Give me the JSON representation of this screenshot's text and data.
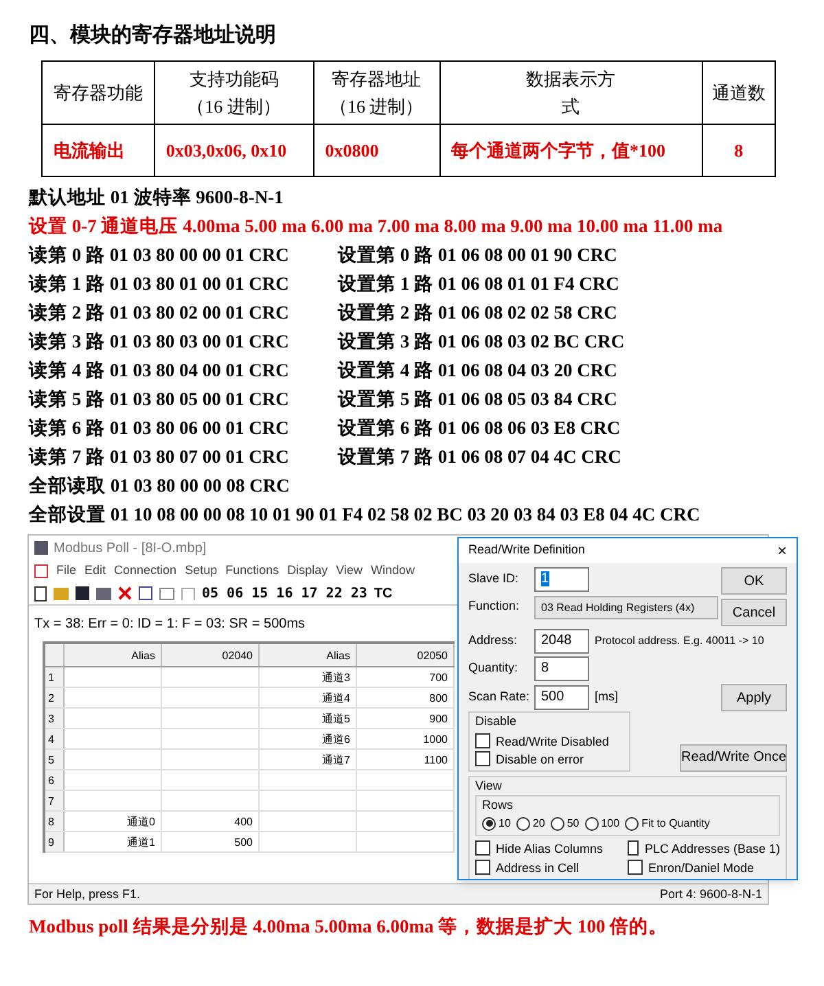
{
  "heading": "四、模块的寄存器地址说明",
  "table": {
    "columns": [
      "寄存器功能",
      "支持功能码（16 进制）",
      "寄存器地址（16 进制）",
      "数据表示方式",
      "通道数"
    ],
    "rows": [
      [
        "电流输出",
        "0x03,0x06, 0x10",
        "0x0800",
        "每个通道两个字节，值*100",
        "8"
      ]
    ]
  },
  "default_line": "默认地址 01 波特率 9600-8-N-1",
  "set_line": "设置 0-7 通道电压 **4.00ma 5.00 ma 6.00 ma 7.00 ma 8.00 ma 9.00 ma 10.00 ma 11.00 ma**",
  "commands": [
    {
      "read": "读第 0 路 01 03 80 00 00 01 CRC",
      "write": "设置第 0 路 01 06 08 00 01 90 CRC"
    },
    {
      "read": "读第 1 路 01 03 80 01 00 01 CRC",
      "write": "设置第 1 路 01 06 08 01 01 F4 CRC"
    },
    {
      "read": "读第 2 路 01 03 80 02 00 01 CRC",
      "write": "设置第 2 路 01 06 08 02 02 58 CRC"
    },
    {
      "read": "读第 3 路 01 03 80 03 00 01 CRC",
      "write": "设置第 3 路 01 06 08 03 02 BC CRC"
    },
    {
      "read": "读第 4 路 01 03 80 04 00 01 CRC",
      "write": "设置第 4 路 01 06 08 04 03 20 CRC"
    },
    {
      "read": "读第 5 路 01 03 80 05 00 01 CRC",
      "write": "设置第 5 路 01 06 08 05 03 84 CRC"
    },
    {
      "read": "读第 6 路 01 03 80 06 00 01 CRC",
      "write": "设置第 6 路 01 06 08 06 03 E8 CRC"
    },
    {
      "read": "读第 7 路 01 03 80 07 00 01 CRC",
      "write": "设置第 7 路 01 06 08 07 04 4C CRC"
    }
  ],
  "read_all": "全部读取 01 03 80 00 00 08 CRC",
  "write_all": "全部设置 01 10 08 00 00 08 10 01 90 01 F4 02 58 02 BC 03 20 03 84 03 E8 04 4C CRC",
  "app": {
    "title": "Modbus Poll - [8I-O.mbp]",
    "menu": [
      "File",
      "Edit",
      "Connection",
      "Setup",
      "Functions",
      "Display",
      "View",
      "Window"
    ],
    "function_codes": "05 06 15 16 17 22 23",
    "tc": "TC",
    "status_line": "Tx = 38: Err = 0: ID = 1: F = 03: SR = 500ms",
    "grid_columns": [
      "Alias",
      "02040",
      "Alias",
      "02050"
    ],
    "grid_rows": [
      [
        "1",
        "",
        "",
        "通道3",
        "700"
      ],
      [
        "2",
        "",
        "",
        "通道4",
        "800"
      ],
      [
        "3",
        "",
        "",
        "通道5",
        "900"
      ],
      [
        "4",
        "",
        "",
        "通道6",
        "1000"
      ],
      [
        "5",
        "",
        "",
        "通道7",
        "1100"
      ],
      [
        "6",
        "",
        "",
        "",
        ""
      ],
      [
        "7",
        "",
        "",
        "",
        ""
      ],
      [
        "8",
        "通道0",
        "400",
        "",
        ""
      ],
      [
        "9",
        "通道1",
        "500",
        "",
        ""
      ]
    ],
    "status_help": "For Help, press F1.",
    "status_port": "Port 4: 9600-8-N-1"
  },
  "dialog": {
    "title": "Read/Write Definition",
    "close": "×",
    "slave_label": "Slave ID:",
    "slave_value": "1",
    "function_label": "Function:",
    "function_value": "03 Read Holding Registers (4x)",
    "address_label": "Address:",
    "address_value": "2048",
    "address_hint": "Protocol address. E.g. 40011 -> 10",
    "quantity_label": "Quantity:",
    "quantity_value": "8",
    "scan_label": "Scan Rate:",
    "scan_value": "500",
    "scan_unit": "[ms]",
    "buttons": {
      "ok": "OK",
      "cancel": "Cancel",
      "apply": "Apply",
      "once": "Read/Write Once"
    },
    "disable_title": "Disable",
    "disable_options": [
      {
        "label": "Read/Write Disabled",
        "checked": false
      },
      {
        "label": "Disable on error",
        "checked": false
      }
    ],
    "view_title": "View",
    "rows_title": "Rows",
    "rows_options": [
      {
        "label": "10",
        "selected": true
      },
      {
        "label": "20",
        "selected": false
      },
      {
        "label": "50",
        "selected": false
      },
      {
        "label": "100",
        "selected": false
      },
      {
        "label": "Fit to Quantity",
        "selected": false
      }
    ],
    "view_options": [
      {
        "label": "Hide Alias Columns",
        "checked": false
      },
      {
        "label": "PLC Addresses (Base 1)",
        "checked": false
      },
      {
        "label": "Address in Cell",
        "checked": false
      },
      {
        "label": "Enron/Daniel Mode",
        "checked": false
      }
    ]
  },
  "footer": "Modbus poll 结果是分别是 4.00ma 5.00ma 6.00ma 等，数据是扩大 100 倍的。"
}
